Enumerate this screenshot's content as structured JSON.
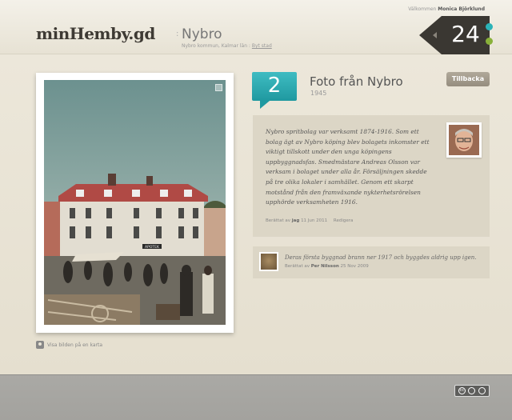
{
  "header": {
    "welcome_prefix": "Välkommen",
    "user_name": "Monica Björklund",
    "logo": "minHemby.gd",
    "separator": ":",
    "town": "Nybro",
    "town_sub": "Nybro kommun, Kalmar län :",
    "change_town": "Byt stad",
    "counter": "24"
  },
  "story": {
    "number": "2",
    "title": "Foto från Nybro",
    "year": "1945",
    "back_label": "Tillbacka",
    "text": "Nybro spritbolag var verksamt 1874-1916. Som ett bolag ägt av Nybro köping blev bolagets inkomster ett viktigt tillskott under den unga köpingens uppbyggnadsfas. Smedmästare Andreas Olsson var verksam i bolaget under alla år. Försäljningen skedde på tre olika lokaler i samhället. Genom ett skarpt motstånd från den framväxande nykterhetsrörelsen upphörde verksamheten 1916.",
    "meta_prefix": "Berättat av",
    "meta_author": "jag",
    "meta_date": "11 Jun 2011",
    "edit_label": "Redigera"
  },
  "photo": {
    "sign_text": "APOTEK",
    "map_link": "Visa bilden på en karta"
  },
  "comment": {
    "text": "Deras första byggnad brann ner 1917 och byggdes aldrig upp igen.",
    "meta_prefix": "Berättat av",
    "meta_author": "Per Nilsson",
    "meta_date": "25 Nov 2009"
  },
  "footer": {
    "license": "cc"
  },
  "colors": {
    "accent_teal": "#2bb3b8",
    "accent_green": "#89b13a",
    "counter_bg": "#3a3732"
  }
}
